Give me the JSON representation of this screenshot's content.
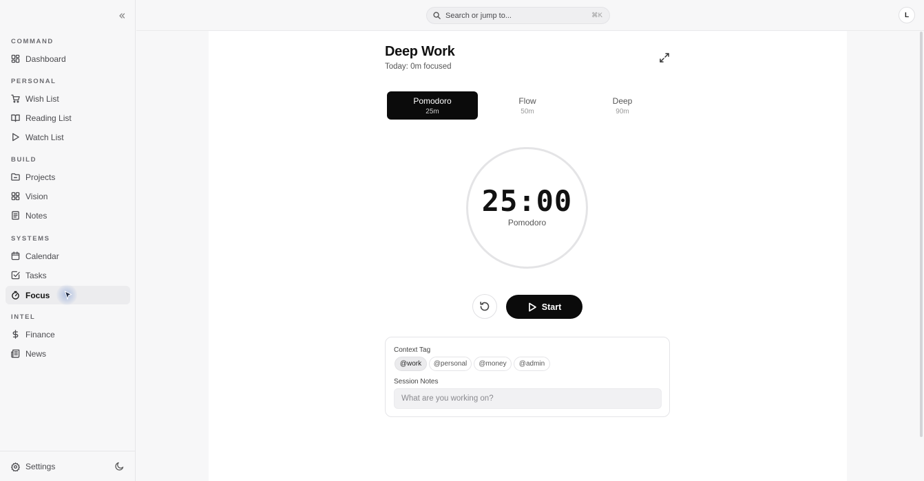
{
  "sidebar": {
    "sections": [
      {
        "label": "COMMAND",
        "items": [
          {
            "label": "Dashboard",
            "icon": "dashboard-icon"
          }
        ]
      },
      {
        "label": "PERSONAL",
        "items": [
          {
            "label": "Wish List",
            "icon": "cart-icon"
          },
          {
            "label": "Reading List",
            "icon": "book-icon"
          },
          {
            "label": "Watch List",
            "icon": "play-icon"
          }
        ]
      },
      {
        "label": "BUILD",
        "items": [
          {
            "label": "Projects",
            "icon": "folder-icon"
          },
          {
            "label": "Vision",
            "icon": "grid-icon"
          },
          {
            "label": "Notes",
            "icon": "notes-icon"
          }
        ]
      },
      {
        "label": "SYSTEMS",
        "items": [
          {
            "label": "Calendar",
            "icon": "calendar-icon"
          },
          {
            "label": "Tasks",
            "icon": "checkbox-icon"
          },
          {
            "label": "Focus",
            "icon": "timer-icon",
            "active": true
          }
        ]
      },
      {
        "label": "INTEL",
        "items": [
          {
            "label": "Finance",
            "icon": "dollar-icon"
          },
          {
            "label": "News",
            "icon": "newspaper-icon"
          }
        ]
      }
    ],
    "footer": {
      "settings_label": "Settings"
    }
  },
  "topbar": {
    "search_placeholder": "Search or jump to...",
    "search_shortcut": "⌘K",
    "avatar_initial": "L"
  },
  "focus": {
    "title": "Deep Work",
    "subtitle": "Today: 0m focused",
    "modes": [
      {
        "name": "Pomodoro",
        "duration": "25m",
        "active": true
      },
      {
        "name": "Flow",
        "duration": "50m",
        "active": false
      },
      {
        "name": "Deep",
        "duration": "90m",
        "active": false
      }
    ],
    "timer": {
      "value": "25:00",
      "label": "Pomodoro"
    },
    "start_label": "Start",
    "context": {
      "tag_label": "Context Tag",
      "tags": [
        {
          "label": "@work",
          "active": true
        },
        {
          "label": "@personal",
          "active": false
        },
        {
          "label": "@money",
          "active": false
        },
        {
          "label": "@admin",
          "active": false
        }
      ],
      "notes_label": "Session Notes",
      "notes_placeholder": "What are you working on?"
    }
  },
  "colors": {
    "accent": "#0b0b0b",
    "background": "#f7f7f8",
    "panel": "#ffffff"
  }
}
